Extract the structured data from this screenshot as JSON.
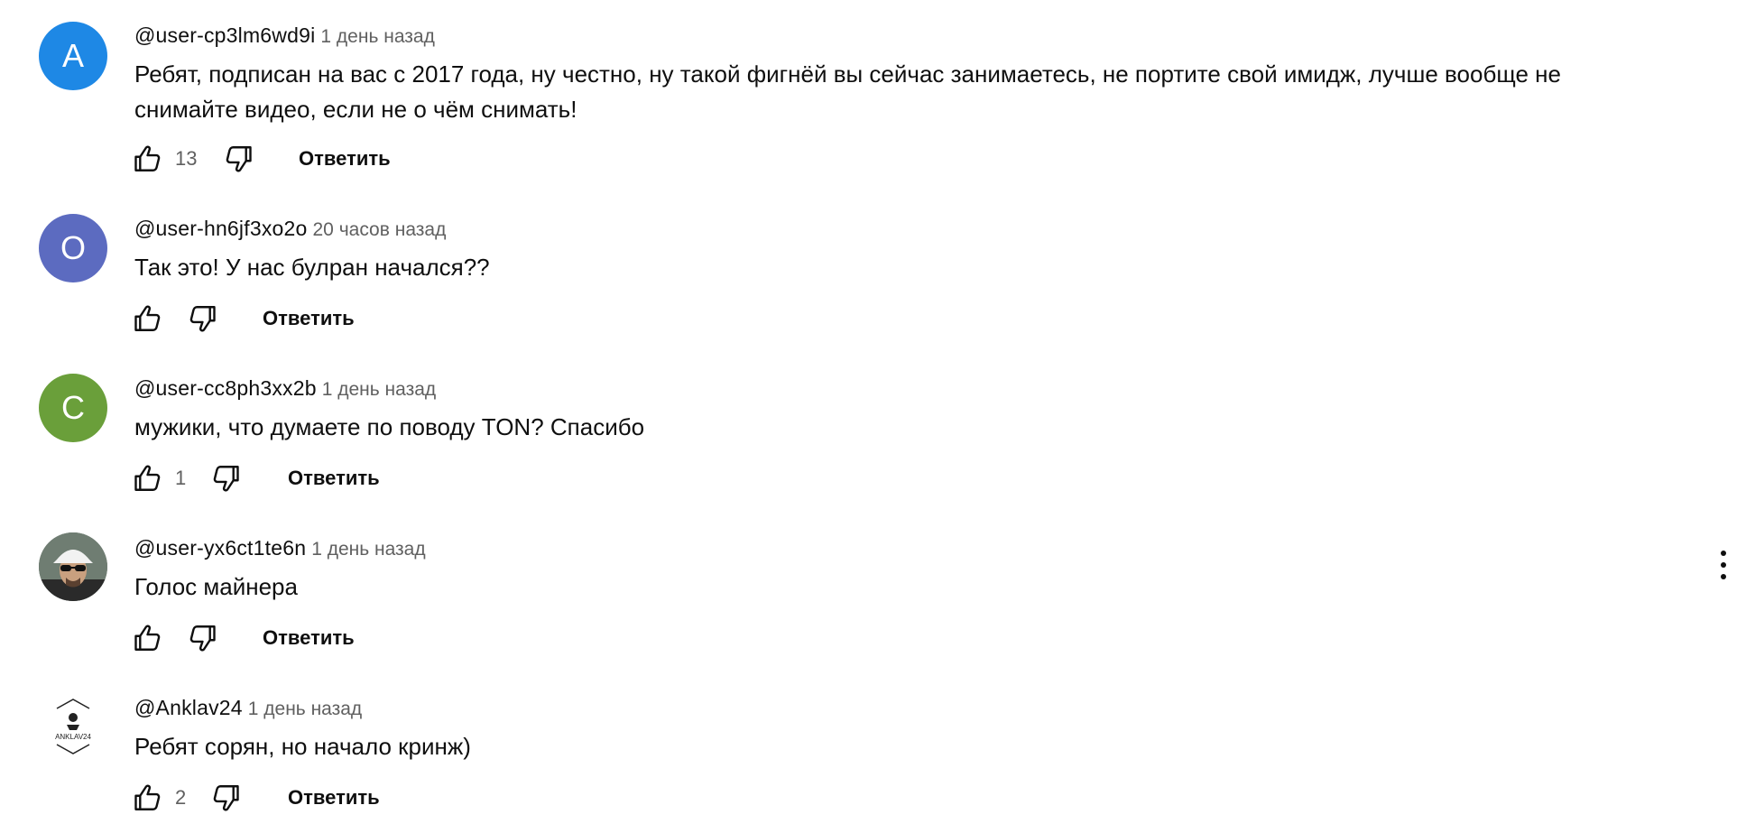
{
  "reply_label": "Ответить",
  "colors": {
    "text": "#0f0f0f",
    "secondary": "#606060",
    "avatar_a": "#1e88e5",
    "avatar_o": "#5c6bc0",
    "avatar_c": "#6a9f3a"
  },
  "comments": [
    {
      "avatar_letter": "A",
      "author": "@user-cp3lm6wd9i",
      "time": "1 день назад",
      "text": "Ребят, подписан на вас с 2017 года, ну честно, ну такой фигнёй вы сейчас занимаетесь, не портите свой имидж, лучше вообще не снимайте видео, если не о чём снимать!",
      "likes": "13"
    },
    {
      "avatar_letter": "O",
      "author": "@user-hn6jf3xo2o",
      "time": "20 часов назад",
      "text": "Так это! У нас булран начался??",
      "likes": ""
    },
    {
      "avatar_letter": "C",
      "author": "@user-cc8ph3xx2b",
      "time": "1 день назад",
      "text": "мужики, что думаете по поводу TON? Спасибо",
      "likes": "1"
    },
    {
      "avatar_letter": "",
      "author": "@user-yx6ct1te6n",
      "time": "1 день назад",
      "text": "Голос майнера",
      "likes": ""
    },
    {
      "avatar_letter": "",
      "avatar_logo_text": "ANKLAV24",
      "author": "@Anklav24",
      "time": "1 день назад",
      "text": "Ребят сорян, но начало кринж)",
      "likes": "2"
    }
  ],
  "icons": {
    "like": "thumbs-up-icon",
    "dislike": "thumbs-down-icon",
    "menu": "more-vert-icon"
  }
}
